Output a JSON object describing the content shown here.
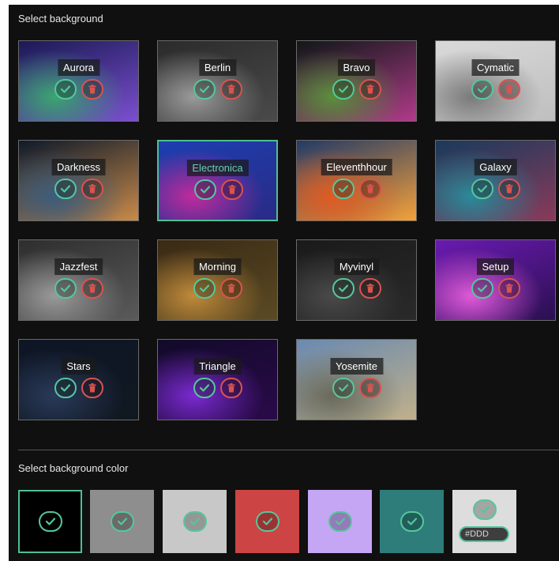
{
  "background_section": {
    "title": "Select background",
    "tiles": [
      {
        "name": "Aurora",
        "colors": [
          "#1b1a55",
          "#3aa570",
          "#7b4fd0"
        ]
      },
      {
        "name": "Berlin",
        "colors": [
          "#2b2b2b",
          "#9a9a9a",
          "#4a4a4a"
        ]
      },
      {
        "name": "Bravo",
        "colors": [
          "#101818",
          "#5a8f3b",
          "#b13a8a"
        ]
      },
      {
        "name": "Cymatic",
        "colors": [
          "#d9d9d9",
          "#7a7a7a",
          "#bfbfbf"
        ]
      },
      {
        "name": "Darkness",
        "colors": [
          "#0e1a2a",
          "#3b5d7d",
          "#c98a4a"
        ]
      },
      {
        "name": "Electronica",
        "colors": [
          "#1d3fb0",
          "#c22a9c",
          "#2a2a86"
        ]
      },
      {
        "name": "Eleventhhour",
        "colors": [
          "#233a66",
          "#e05a22",
          "#f4a13a"
        ]
      },
      {
        "name": "Galaxy",
        "colors": [
          "#1a3a5c",
          "#2a8a9a",
          "#8a3a5a"
        ]
      },
      {
        "name": "Jazzfest",
        "colors": [
          "#2e2e2e",
          "#9a9a9a",
          "#5a5a5a"
        ]
      },
      {
        "name": "Morning",
        "colors": [
          "#3a2a14",
          "#c08a3a",
          "#5a4a24"
        ]
      },
      {
        "name": "Myvinyl",
        "colors": [
          "#1a1a1a",
          "#4a4a4a",
          "#2a2a2a"
        ]
      },
      {
        "name": "Setup",
        "colors": [
          "#6a1ab0",
          "#e05ad8",
          "#2a1050"
        ]
      },
      {
        "name": "Stars",
        "colors": [
          "#0e1626",
          "#2a3a5a",
          "#101820"
        ]
      },
      {
        "name": "Triangle",
        "colors": [
          "#120a2a",
          "#7a2ad0",
          "#2a0a4a"
        ]
      },
      {
        "name": "Yosemite",
        "colors": [
          "#6a8ab0",
          "#6a6a5a",
          "#c0b08a"
        ]
      }
    ],
    "selected": "Electronica"
  },
  "color_section": {
    "title": "Select background color",
    "swatches": [
      "#000000",
      "#8e8e8e",
      "#c8c8c8",
      "#cc4444",
      "#c4a6f4",
      "#2e7d7a"
    ],
    "selected_index": 0,
    "custom_color": {
      "value": "#DDD",
      "color": "#dddddd"
    }
  },
  "icons": {
    "check": "check-icon",
    "delete": "trash-icon"
  },
  "colors": {
    "accent": "#55c79c",
    "danger": "#d9534f"
  }
}
